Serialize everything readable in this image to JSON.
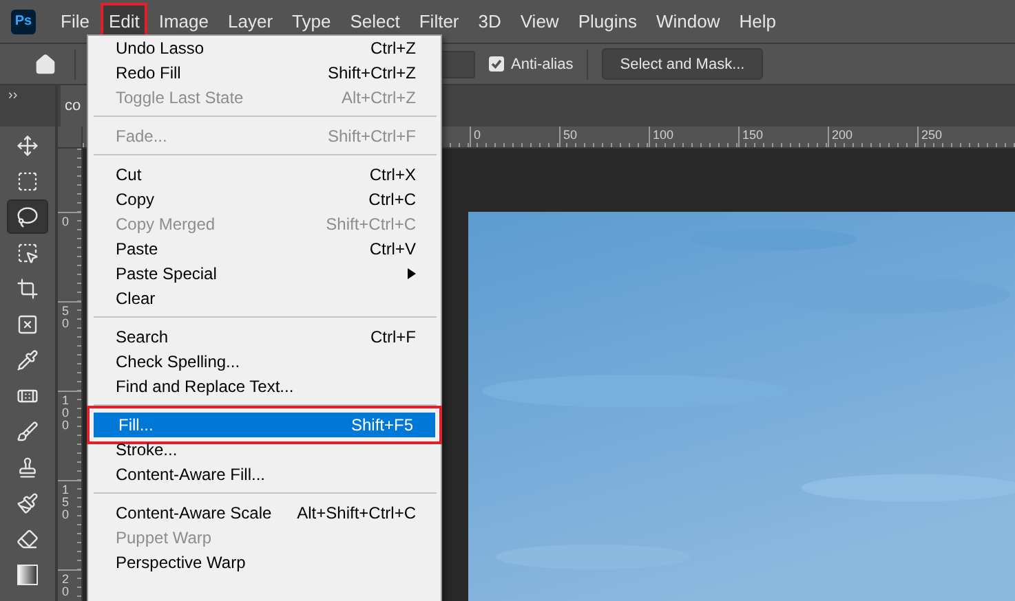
{
  "app_logo": "Ps",
  "menubar": [
    {
      "label": "File",
      "selected": false
    },
    {
      "label": "Edit",
      "selected": true
    },
    {
      "label": "Image",
      "selected": false
    },
    {
      "label": "Layer",
      "selected": false
    },
    {
      "label": "Type",
      "selected": false
    },
    {
      "label": "Select",
      "selected": false
    },
    {
      "label": "Filter",
      "selected": false
    },
    {
      "label": "3D",
      "selected": false
    },
    {
      "label": "View",
      "selected": false
    },
    {
      "label": "Plugins",
      "selected": false
    },
    {
      "label": "Window",
      "selected": false
    },
    {
      "label": "Help",
      "selected": false
    }
  ],
  "options_bar": {
    "anti_alias": {
      "label": "Anti-alias",
      "checked": true
    },
    "select_and_mask": "Select and Mask..."
  },
  "toolbar": {
    "collapse": "››",
    "tools": [
      {
        "kind": "move",
        "selected": false
      },
      {
        "kind": "marquee",
        "selected": false
      },
      {
        "kind": "lasso",
        "selected": true
      },
      {
        "kind": "object",
        "selected": false
      },
      {
        "kind": "crop",
        "selected": false
      },
      {
        "kind": "frame",
        "selected": false
      },
      {
        "kind": "eyedropper",
        "selected": false
      },
      {
        "kind": "healing",
        "selected": false
      },
      {
        "kind": "brush",
        "selected": false
      },
      {
        "kind": "stamp",
        "selected": false
      },
      {
        "kind": "history",
        "selected": false
      },
      {
        "kind": "eraser",
        "selected": false
      },
      {
        "kind": "gradient",
        "selected": false
      }
    ]
  },
  "document_tab": "co",
  "horizontal_ruler": [
    "0",
    "50",
    "100",
    "150",
    "200",
    "250"
  ],
  "vertical_ruler": [
    "0",
    "50",
    "100",
    "150",
    "20"
  ],
  "edit_menu": [
    {
      "kind": "item",
      "label": "Undo Lasso",
      "shortcut": "Ctrl+Z",
      "disabled": false,
      "selected": false
    },
    {
      "kind": "item",
      "label": "Redo Fill",
      "shortcut": "Shift+Ctrl+Z",
      "disabled": false,
      "selected": false
    },
    {
      "kind": "item",
      "label": "Toggle Last State",
      "shortcut": "Alt+Ctrl+Z",
      "disabled": true,
      "selected": false
    },
    {
      "kind": "separator"
    },
    {
      "kind": "item",
      "label": "Fade...",
      "shortcut": "Shift+Ctrl+F",
      "disabled": true,
      "selected": false
    },
    {
      "kind": "separator"
    },
    {
      "kind": "item",
      "label": "Cut",
      "shortcut": "Ctrl+X",
      "disabled": false,
      "selected": false
    },
    {
      "kind": "item",
      "label": "Copy",
      "shortcut": "Ctrl+C",
      "disabled": false,
      "selected": false
    },
    {
      "kind": "item",
      "label": "Copy Merged",
      "shortcut": "Shift+Ctrl+C",
      "disabled": true,
      "selected": false
    },
    {
      "kind": "item",
      "label": "Paste",
      "shortcut": "Ctrl+V",
      "disabled": false,
      "selected": false
    },
    {
      "kind": "submenu",
      "label": "Paste Special",
      "disabled": false,
      "selected": false
    },
    {
      "kind": "item",
      "label": "Clear",
      "disabled": false,
      "selected": false
    },
    {
      "kind": "separator"
    },
    {
      "kind": "item",
      "label": "Search",
      "shortcut": "Ctrl+F",
      "disabled": false,
      "selected": false
    },
    {
      "kind": "item",
      "label": "Check Spelling...",
      "disabled": false,
      "selected": false
    },
    {
      "kind": "item",
      "label": "Find and Replace Text...",
      "disabled": false,
      "selected": false
    },
    {
      "kind": "separator"
    },
    {
      "kind": "item",
      "label": "Fill...",
      "shortcut": "Shift+F5",
      "disabled": false,
      "selected": true
    },
    {
      "kind": "item",
      "label": "Stroke...",
      "disabled": false,
      "selected": false
    },
    {
      "kind": "item",
      "label": "Content-Aware Fill...",
      "disabled": false,
      "selected": false
    },
    {
      "kind": "separator"
    },
    {
      "kind": "item",
      "label": "Content-Aware Scale",
      "shortcut": "Alt+Shift+Ctrl+C",
      "disabled": false,
      "selected": false
    },
    {
      "kind": "item",
      "label": "Puppet Warp",
      "disabled": true,
      "selected": false
    },
    {
      "kind": "item",
      "label": "Perspective Warp",
      "disabled": false,
      "selected": false
    }
  ]
}
